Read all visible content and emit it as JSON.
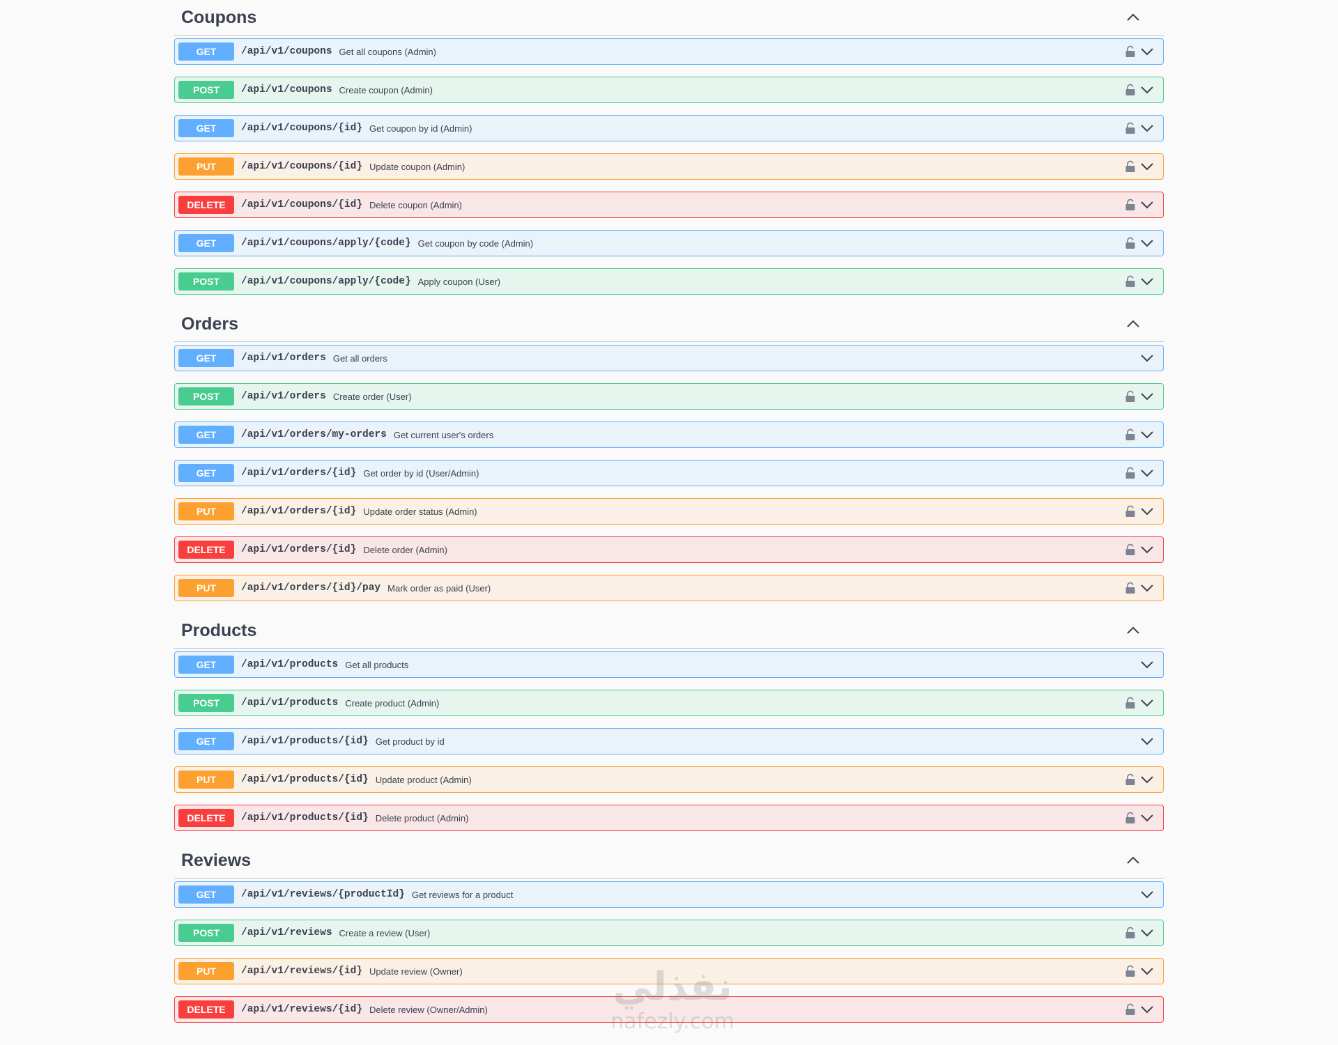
{
  "sections": [
    {
      "title": "Coupons",
      "operations": [
        {
          "method": "GET",
          "kind": "get",
          "path": "/api/v1/coupons",
          "summary": "Get all coupons (Admin)",
          "lock": true
        },
        {
          "method": "POST",
          "kind": "post",
          "path": "/api/v1/coupons",
          "summary": "Create coupon (Admin)",
          "lock": true
        },
        {
          "method": "GET",
          "kind": "get",
          "path": "/api/v1/coupons/{id}",
          "summary": "Get coupon by id (Admin)",
          "lock": true
        },
        {
          "method": "PUT",
          "kind": "put",
          "path": "/api/v1/coupons/{id}",
          "summary": "Update coupon (Admin)",
          "lock": true
        },
        {
          "method": "DELETE",
          "kind": "delete",
          "path": "/api/v1/coupons/{id}",
          "summary": "Delete coupon (Admin)",
          "lock": true
        },
        {
          "method": "GET",
          "kind": "get",
          "path": "/api/v1/coupons/apply/{code}",
          "summary": "Get coupon by code (Admin)",
          "lock": true
        },
        {
          "method": "POST",
          "kind": "post",
          "path": "/api/v1/coupons/apply/{code}",
          "summary": "Apply coupon (User)",
          "lock": true
        }
      ]
    },
    {
      "title": "Orders",
      "operations": [
        {
          "method": "GET",
          "kind": "get",
          "path": "/api/v1/orders",
          "summary": "Get all orders",
          "lock": false
        },
        {
          "method": "POST",
          "kind": "post",
          "path": "/api/v1/orders",
          "summary": "Create order (User)",
          "lock": true
        },
        {
          "method": "GET",
          "kind": "get",
          "path": "/api/v1/orders/my-orders",
          "summary": "Get current user's orders",
          "lock": true
        },
        {
          "method": "GET",
          "kind": "get",
          "path": "/api/v1/orders/{id}",
          "summary": "Get order by id (User/Admin)",
          "lock": true
        },
        {
          "method": "PUT",
          "kind": "put",
          "path": "/api/v1/orders/{id}",
          "summary": "Update order status (Admin)",
          "lock": true
        },
        {
          "method": "DELETE",
          "kind": "delete",
          "path": "/api/v1/orders/{id}",
          "summary": "Delete order (Admin)",
          "lock": true
        },
        {
          "method": "PUT",
          "kind": "put",
          "path": "/api/v1/orders/{id}/pay",
          "summary": "Mark order as paid (User)",
          "lock": true
        }
      ]
    },
    {
      "title": "Products",
      "operations": [
        {
          "method": "GET",
          "kind": "get",
          "path": "/api/v1/products",
          "summary": "Get all products",
          "lock": false
        },
        {
          "method": "POST",
          "kind": "post",
          "path": "/api/v1/products",
          "summary": "Create product (Admin)",
          "lock": true
        },
        {
          "method": "GET",
          "kind": "get",
          "path": "/api/v1/products/{id}",
          "summary": "Get product by id",
          "lock": false
        },
        {
          "method": "PUT",
          "kind": "put",
          "path": "/api/v1/products/{id}",
          "summary": "Update product (Admin)",
          "lock": true
        },
        {
          "method": "DELETE",
          "kind": "delete",
          "path": "/api/v1/products/{id}",
          "summary": "Delete product (Admin)",
          "lock": true
        }
      ]
    },
    {
      "title": "Reviews",
      "operations": [
        {
          "method": "GET",
          "kind": "get",
          "path": "/api/v1/reviews/{productId}",
          "summary": "Get reviews for a product",
          "lock": false
        },
        {
          "method": "POST",
          "kind": "post",
          "path": "/api/v1/reviews",
          "summary": "Create a review (User)",
          "lock": true
        },
        {
          "method": "PUT",
          "kind": "put",
          "path": "/api/v1/reviews/{id}",
          "summary": "Update review (Owner)",
          "lock": true
        },
        {
          "method": "DELETE",
          "kind": "delete",
          "path": "/api/v1/reviews/{id}",
          "summary": "Delete review (Owner/Admin)",
          "lock": true
        }
      ]
    }
  ],
  "watermark": {
    "arabic": "نفذلي",
    "latin": "nafezly.com"
  },
  "colors": {
    "get": "#61affe",
    "post": "#49cc90",
    "put": "#fca130",
    "delete": "#f93e3e",
    "text": "#3b4151",
    "icon": "#7d8492"
  }
}
